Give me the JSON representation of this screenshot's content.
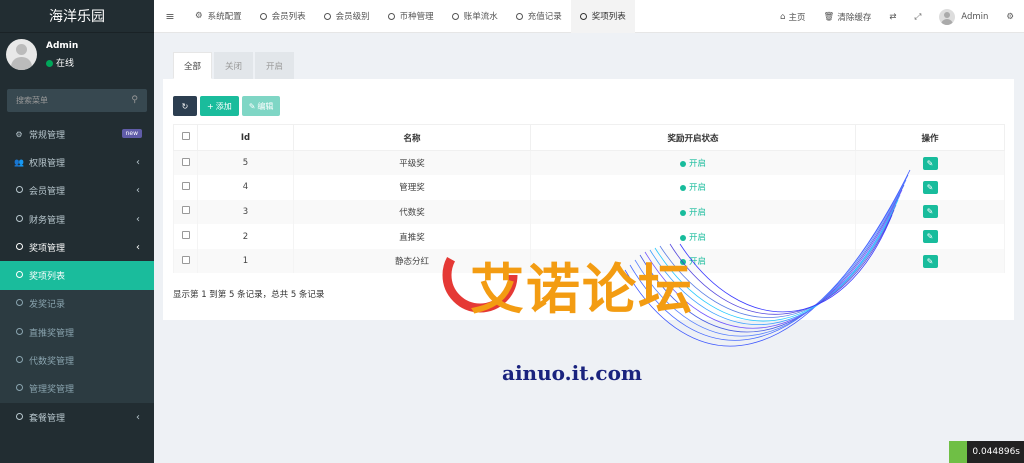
{
  "app": {
    "title": "海洋乐园"
  },
  "user": {
    "name": "Admin",
    "status": "在线"
  },
  "search": {
    "placeholder": "搜索菜单"
  },
  "sidebar": {
    "items": [
      {
        "label": "常规管理",
        "badge": "new"
      },
      {
        "label": "权限管理"
      },
      {
        "label": "会员管理"
      },
      {
        "label": "财务管理"
      },
      {
        "label": "奖项管理"
      },
      {
        "label": "奖项列表"
      },
      {
        "label": "发奖记录"
      },
      {
        "label": "直推奖管理"
      },
      {
        "label": "代数奖管理"
      },
      {
        "label": "管理奖管理"
      },
      {
        "label": "套餐管理"
      }
    ]
  },
  "topnav": {
    "tabs": [
      "系统配置",
      "会员列表",
      "会员级别",
      "币种管理",
      "账单流水",
      "充值记录",
      "奖项列表"
    ],
    "home": "主页",
    "clear_cache": "清除缓存",
    "admin": "Admin"
  },
  "content": {
    "tabs": [
      "全部",
      "关闭",
      "开启"
    ],
    "toolbar": {
      "add": "添加",
      "edit": "编辑"
    },
    "table": {
      "headers": [
        "Id",
        "名称",
        "奖励开启状态",
        "操作"
      ],
      "rows": [
        {
          "id": "5",
          "name": "平级奖",
          "status": "开启"
        },
        {
          "id": "4",
          "name": "管理奖",
          "status": "开启"
        },
        {
          "id": "3",
          "name": "代数奖",
          "status": "开启"
        },
        {
          "id": "2",
          "name": "直推奖",
          "status": "开启"
        },
        {
          "id": "1",
          "name": "静态分红",
          "status": "开启"
        }
      ]
    },
    "footer": "显示第 1 到第 5 条记录，总共 5 条记录"
  },
  "watermark": {
    "title": "艾诺论坛",
    "url": "ainuo.it.com"
  },
  "timer": "0.044896s",
  "colors": {
    "accent": "#1abc9c",
    "sidebar": "#222d32",
    "brand_orange": "#f39c12"
  }
}
